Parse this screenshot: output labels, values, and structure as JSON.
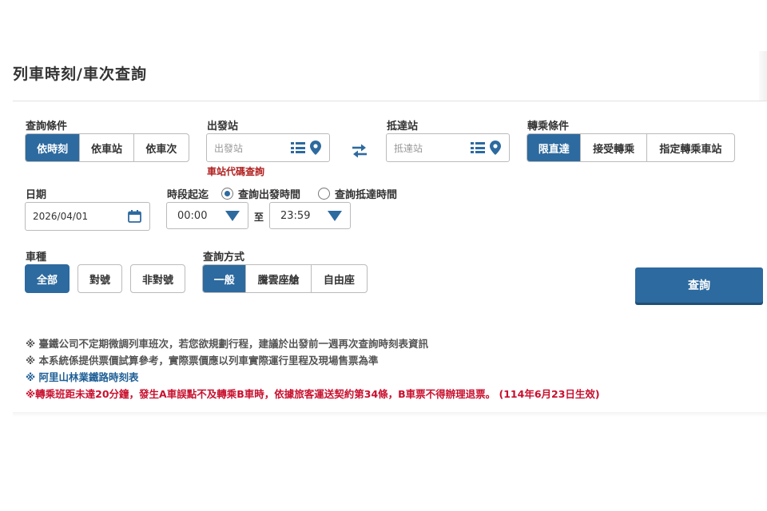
{
  "page_title": "列車時刻/車次查詢",
  "query_condition": {
    "label": "查詢條件",
    "options": [
      "依時刻",
      "依車站",
      "依車次"
    ],
    "selected": "依時刻"
  },
  "departure": {
    "label": "出發站",
    "placeholder": "出發站",
    "station_code_link": "車站代碼查詢"
  },
  "arrival": {
    "label": "抵達站",
    "placeholder": "抵達站"
  },
  "transfer": {
    "label": "轉乘條件",
    "options": [
      "限直達",
      "接受轉乘",
      "指定轉乘車站"
    ],
    "selected": "限直達"
  },
  "date": {
    "label": "日期",
    "value": "2026/04/01"
  },
  "time_range": {
    "label": "時段起迄",
    "radio_departure": "查詢出發時間",
    "radio_arrival": "查詢抵達時間",
    "selected": "查詢出發時間",
    "from": "00:00",
    "to_label": "至",
    "to": "23:59"
  },
  "train_type": {
    "label": "車種",
    "options": [
      "全部",
      "對號",
      "非對號"
    ],
    "selected": "全部"
  },
  "query_mode": {
    "label": "查詢方式",
    "options": [
      "一般",
      "騰雲座艙",
      "自由座"
    ],
    "selected": "一般"
  },
  "search_button": "查詢",
  "notes": [
    "※ 臺鐵公司不定期微調列車班次，若您欲規劃行程，建議於出發前一週再次查詢時刻表資訊",
    "※ 本系統係提供票價試算參考，實際票價應以列車實際運行里程及現場售票為準"
  ],
  "alishan_link": "※ 阿里山林業鐵路時刻表",
  "transfer_warning": "※轉乘班距未達20分鐘，發生A車誤點不及轉乘B車時，依據旅客運送契約第34條，B車票不得辦理退票。 (114年6月23日生效)",
  "colors": {
    "primary": "#2d6a9f",
    "warning": "#c8102e",
    "link": "#1f5f96"
  }
}
